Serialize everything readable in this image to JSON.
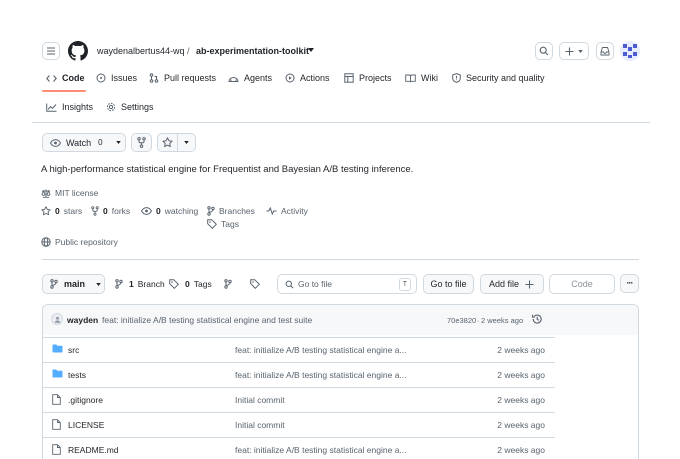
{
  "header": {
    "owner": "waydenalbertus44-wq",
    "separator": "/",
    "repo": "ab-experimentation-toolkit"
  },
  "nav": {
    "tabs": [
      {
        "label": "Code",
        "icon": "code-icon"
      },
      {
        "label": "Issues",
        "icon": "issue-icon"
      },
      {
        "label": "Pull requests",
        "icon": "pull-request-icon"
      },
      {
        "label": "Agents",
        "icon": "agent-icon"
      },
      {
        "label": "Actions",
        "icon": "play-icon"
      },
      {
        "label": "Projects",
        "icon": "table-icon"
      },
      {
        "label": "Wiki",
        "icon": "book-icon"
      },
      {
        "label": "Security and quality",
        "icon": "shield-icon"
      },
      {
        "label": "Insights",
        "icon": "graph-icon"
      },
      {
        "label": "Settings",
        "icon": "gear-icon"
      }
    ]
  },
  "repo_actions": {
    "watch_label": "Watch",
    "watch_count": "0"
  },
  "about": {
    "description": "A high-performance statistical engine for Frequentist and Bayesian A/B testing inference.",
    "license": "MIT license",
    "stars_count": "0",
    "stars_label": "stars",
    "forks_count": "0",
    "forks_label": "forks",
    "watching_count": "0",
    "watching_label": "watching",
    "branches_label": "Branches",
    "activity_label": "Activity",
    "tags_label": "Tags",
    "visibility": "Public repository"
  },
  "file_nav": {
    "branch": "main",
    "branch_count": "1",
    "branch_label": "Branch",
    "tag_count": "0",
    "tag_label": "Tags",
    "search_placeholder": "Go to file",
    "search_shortcut": "T",
    "go_to_file": "Go to file",
    "add_file": "Add file",
    "code": "Code",
    "more": "···"
  },
  "latest_commit": {
    "author": "wayden",
    "message": "feat: initialize A/B testing statistical engine and test suite",
    "sha": "70e3820",
    "separator": "·",
    "time": "2 weeks ago"
  },
  "files": [
    {
      "name": "src",
      "type": "folder",
      "message": "feat: initialize A/B testing statistical engine a...",
      "date": "2 weeks ago"
    },
    {
      "name": "tests",
      "type": "folder",
      "message": "feat: initialize A/B testing statistical engine a...",
      "date": "2 weeks ago"
    },
    {
      "name": ".gitignore",
      "type": "file",
      "message": "Initial commit",
      "date": "2 weeks ago"
    },
    {
      "name": "LICENSE",
      "type": "file",
      "message": "Initial commit",
      "date": "2 weeks ago"
    },
    {
      "name": "README.md",
      "type": "file",
      "message": "feat: initialize A/B testing statistical engine a...",
      "date": "2 weeks ago"
    }
  ],
  "colors": {
    "folder": "#54aeff",
    "accent": "#fd8c73",
    "border": "#d1d9e0",
    "muted": "#59636e"
  }
}
